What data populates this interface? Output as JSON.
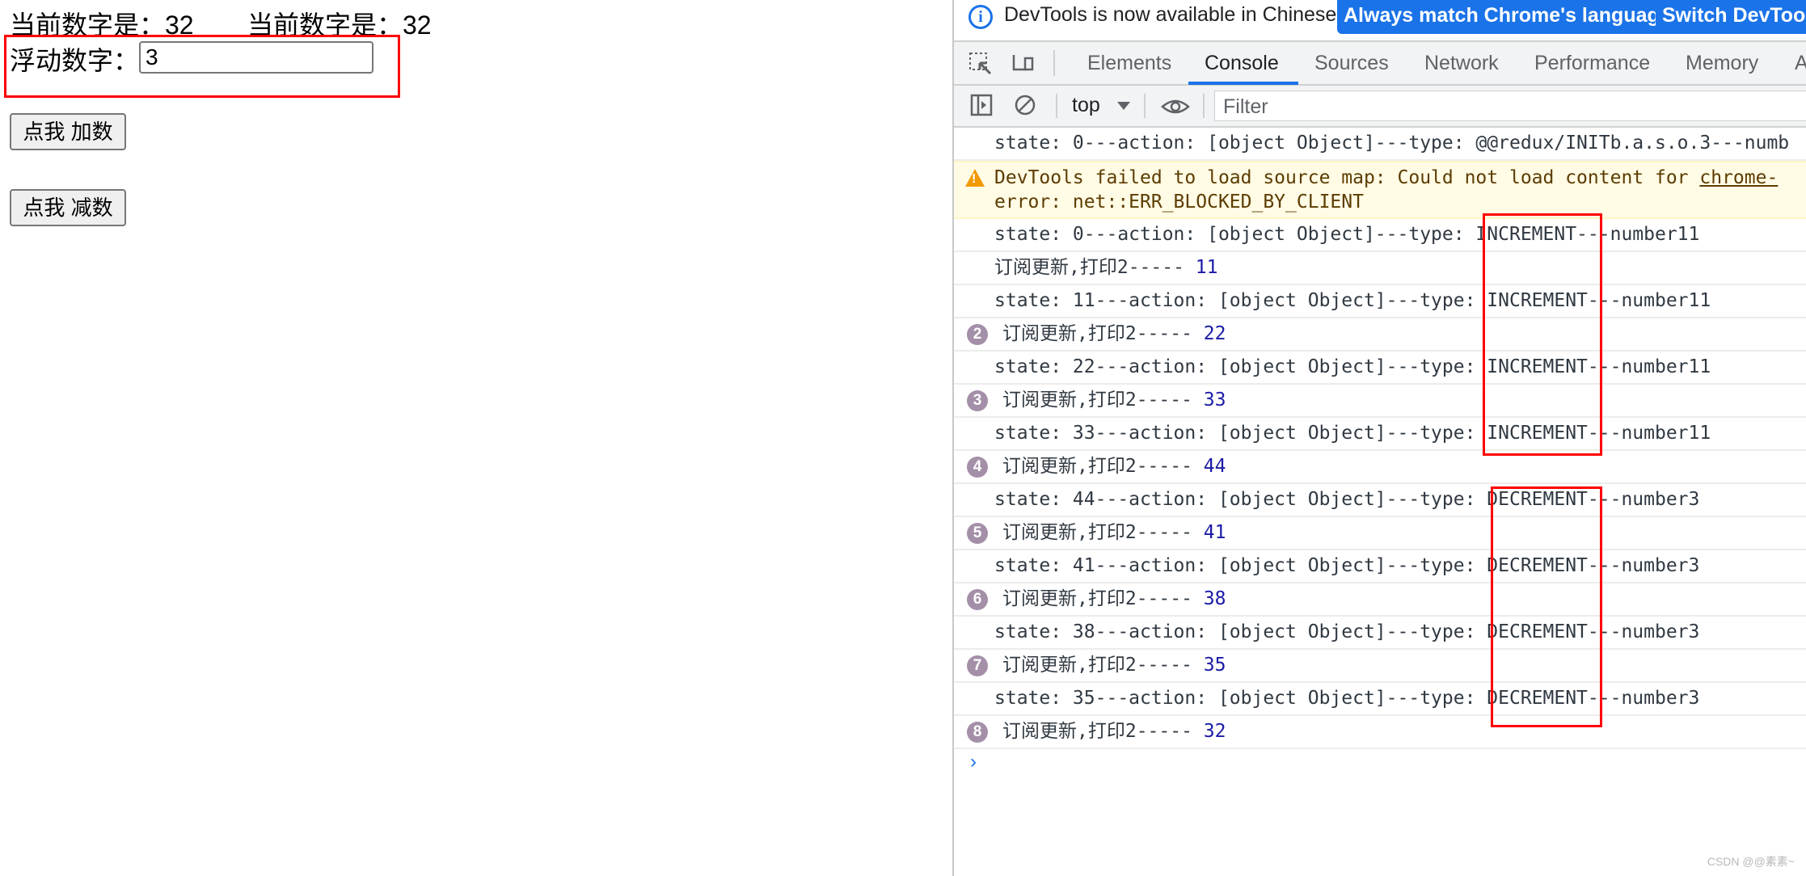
{
  "page": {
    "current_label_1": "当前数字是：32",
    "current_label_2": "当前数字是：32",
    "float_label": "浮动数字：",
    "float_value": "3",
    "add_button": "点我 加数",
    "sub_button": "点我 减数"
  },
  "devtools": {
    "info_text": "DevTools is now available in Chinese!",
    "match_language_button": "Always match Chrome's language",
    "switch_button": "Switch DevTools",
    "tabs": [
      "Elements",
      "Console",
      "Sources",
      "Network",
      "Performance",
      "Memory",
      "A"
    ],
    "active_tab": "Console",
    "context": "top",
    "filter_placeholder": "Filter",
    "accent_color": "#1a73e8"
  },
  "console": {
    "rows": [
      {
        "kind": "log",
        "text": "state: 0---action: [object Object]---type: @@redux/INITb.a.s.o.3---numb"
      },
      {
        "kind": "warn",
        "line1_prefix": "DevTools failed to load source map: Could not load content for ",
        "line1_link": "chrome-",
        "line2": "error: net::ERR_BLOCKED_BY_CLIENT"
      },
      {
        "kind": "log",
        "text": "state: 0---action: [object Object]---type: INCREMENT---number11"
      },
      {
        "kind": "sub",
        "prefix": "订阅更新,打印2----- ",
        "value": "11",
        "count": ""
      },
      {
        "kind": "log",
        "text": "state: 11---action: [object Object]---type: INCREMENT---number11"
      },
      {
        "kind": "sub",
        "prefix": "订阅更新,打印2----- ",
        "value": "22",
        "count": "2"
      },
      {
        "kind": "log",
        "text": "state: 22---action: [object Object]---type: INCREMENT---number11"
      },
      {
        "kind": "sub",
        "prefix": "订阅更新,打印2----- ",
        "value": "33",
        "count": "3"
      },
      {
        "kind": "log",
        "text": "state: 33---action: [object Object]---type: INCREMENT---number11"
      },
      {
        "kind": "sub",
        "prefix": "订阅更新,打印2----- ",
        "value": "44",
        "count": "4"
      },
      {
        "kind": "log",
        "text": "state: 44---action: [object Object]---type: DECREMENT---number3"
      },
      {
        "kind": "sub",
        "prefix": "订阅更新,打印2----- ",
        "value": "41",
        "count": "5"
      },
      {
        "kind": "log",
        "text": "state: 41---action: [object Object]---type: DECREMENT---number3"
      },
      {
        "kind": "sub",
        "prefix": "订阅更新,打印2----- ",
        "value": "38",
        "count": "6"
      },
      {
        "kind": "log",
        "text": "state: 38---action: [object Object]---type: DECREMENT---number3"
      },
      {
        "kind": "sub",
        "prefix": "订阅更新,打印2----- ",
        "value": "35",
        "count": "7"
      },
      {
        "kind": "log",
        "text": "state: 35---action: [object Object]---type: DECREMENT---number3"
      },
      {
        "kind": "sub",
        "prefix": "订阅更新,打印2----- ",
        "value": "32",
        "count": "8"
      }
    ],
    "prompt": "›"
  },
  "watermark": "CSDN @@素素~"
}
